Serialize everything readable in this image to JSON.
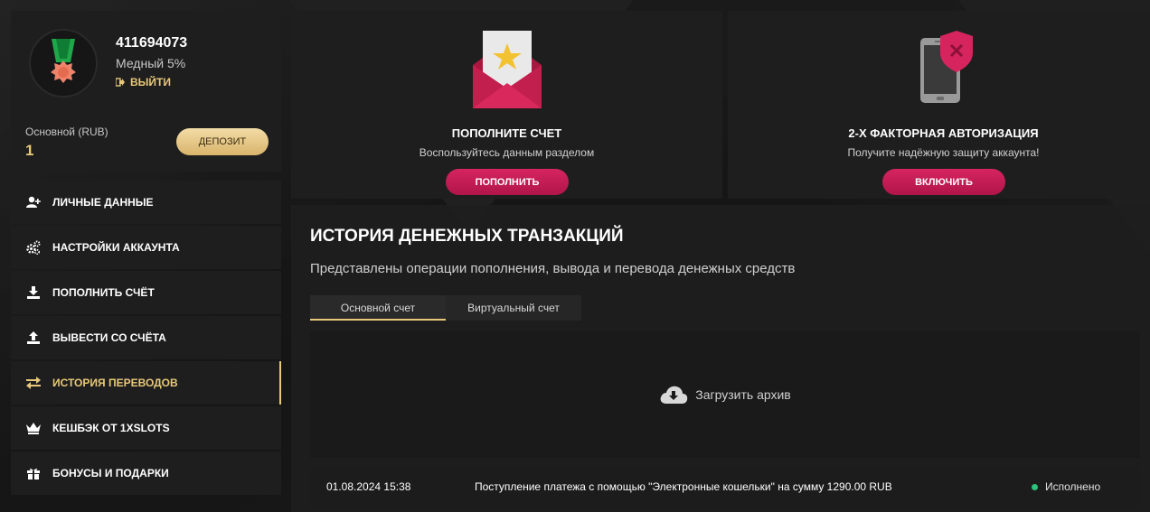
{
  "profile": {
    "user_id": "411694073",
    "level": "Медный 5%",
    "logout_label": "ВЫЙТИ",
    "account_label": "Основной (RUB)",
    "balance": "1",
    "deposit_label": "ДЕПОЗИТ"
  },
  "menu": {
    "items": [
      {
        "label": "ЛИЧНЫЕ ДАННЫЕ",
        "icon": "add-user-icon"
      },
      {
        "label": "НАСТРОЙКИ АККАУНТА",
        "icon": "gears-icon"
      },
      {
        "label": "ПОПОЛНИТЬ СЧЁТ",
        "icon": "download-icon"
      },
      {
        "label": "ВЫВЕСТИ СО СЧЁТА",
        "icon": "upload-icon"
      },
      {
        "label": "ИСТОРИЯ ПЕРЕВОДОВ",
        "icon": "transfer-arrows-icon",
        "active": true
      },
      {
        "label": "КЕШБЭК ОТ 1XSLOTS",
        "icon": "crown-icon"
      },
      {
        "label": "БОНУСЫ И ПОДАРКИ",
        "icon": "gift-icon"
      }
    ]
  },
  "cards": {
    "deposit": {
      "title": "ПОПОЛНИТЕ СЧЕТ",
      "subtitle": "Воспользуйтесь данным разделом",
      "button": "ПОПОЛНИТЬ",
      "icon": "envelope-star-icon"
    },
    "twofa": {
      "title": "2-Х ФАКТОРНАЯ АВТОРИЗАЦИЯ",
      "subtitle": "Получите надёжную защиту аккаунта!",
      "button": "ВКЛЮЧИТЬ",
      "icon": "phone-shield-icon"
    }
  },
  "history": {
    "title": "ИСТОРИЯ ДЕНЕЖНЫХ ТРАНЗАКЦИЙ",
    "subtitle": "Представлены операции пополнения, вывода и перевода денежных средств",
    "tabs": [
      "Основной счет",
      "Виртуальный счет"
    ],
    "active_tab": 0,
    "archive_label": "Загрузить архив",
    "transactions": [
      {
        "date": "01.08.2024 15:38",
        "description": "Поступление платежа с помощью \"Электронные кошельки\" на сумму 1290.00 RUB",
        "status": "Исполнено",
        "status_color": "#2ec27e"
      }
    ]
  },
  "colors": {
    "accent_gold": "#e8c87a",
    "accent_pink": "#c81c55",
    "panel_bg": "#1e1e1e"
  }
}
